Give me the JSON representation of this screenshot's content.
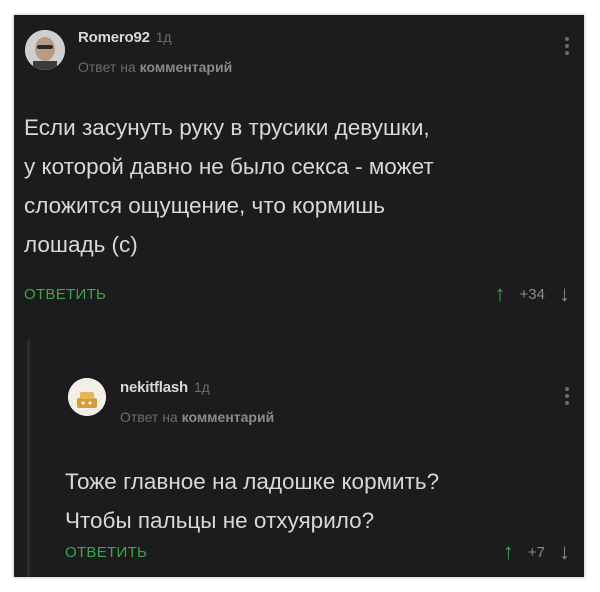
{
  "comments": [
    {
      "username": "Romero92",
      "time": "1д",
      "reply_prefix": "Ответ на",
      "reply_target": "комментарий",
      "text_lines": [
        "Если засунуть руку в трусики девушки,",
        "у которой давно не было секса - может",
        "сложится ощущение, что кормишь",
        "лошадь (с)"
      ],
      "reply_label": "ОТВЕТИТЬ",
      "votes": "+34",
      "icons": {
        "more": "more-vertical-icon",
        "up": "arrow-up-icon",
        "down": "arrow-down-icon"
      }
    },
    {
      "username": "nekitflash",
      "time": "1д",
      "reply_prefix": "Ответ на",
      "reply_target": "комментарий",
      "text_lines": [
        "Тоже главное на ладошке кормить?",
        "Чтобы пальцы не отхуярило?"
      ],
      "reply_label": "ОТВЕТИТЬ",
      "votes": "+7",
      "icons": {
        "more": "more-vertical-icon",
        "up": "arrow-up-icon",
        "down": "arrow-down-icon"
      }
    }
  ],
  "colors": {
    "background": "#1c1c1e",
    "text": "#d8d8da",
    "muted": "#6c6c70",
    "accent": "#3aa74a"
  }
}
